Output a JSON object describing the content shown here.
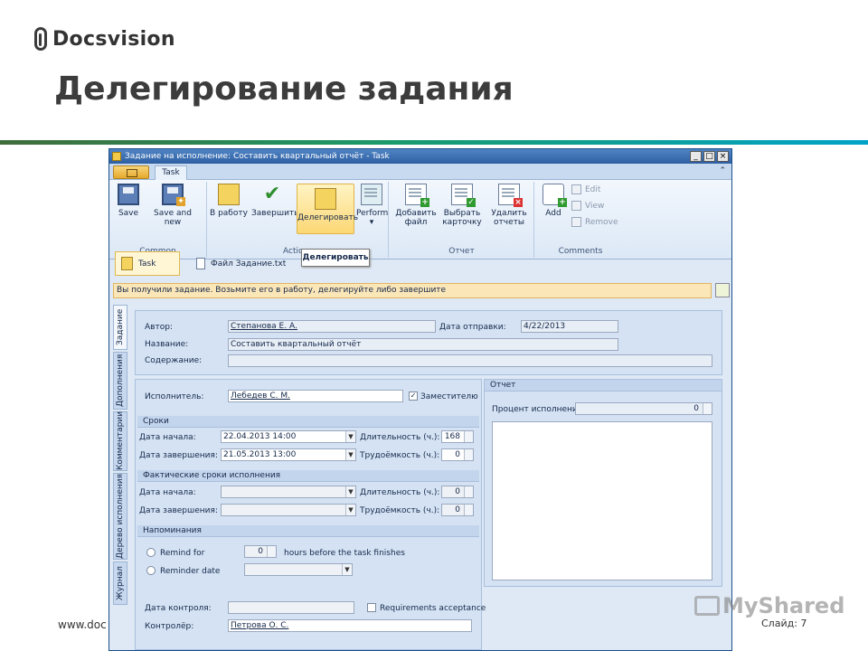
{
  "slide": {
    "logo_text": "Docsvision",
    "title": "Делегирование задания",
    "footer_url": "www.doc",
    "footer_slide": "Слайд: 7",
    "watermark": "MyShared"
  },
  "window": {
    "title": "Задание на исполнение: Составить квартальный отчёт - Task",
    "tab": "Task"
  },
  "ribbon": {
    "groups": {
      "common": "Common",
      "actions": "Actions",
      "otchet": "Отчет",
      "comments": "Comments"
    },
    "buttons": {
      "save": "Save",
      "save_new": "Save and new",
      "take": "В работу",
      "finish": "Завершить",
      "delegate": "Делегировать",
      "perform": "Perform",
      "add_file_1": "Добавить",
      "add_file_2": "файл",
      "choose_card_1": "Выбрать",
      "choose_card_2": "карточку",
      "delete_rep_1": "Удалить",
      "delete_rep_2": "отчеты",
      "add": "Add",
      "edit": "Edit",
      "view": "View",
      "remove": "Remove"
    }
  },
  "cards": {
    "task": "Task",
    "file": "Файл Задание.txt",
    "tooltip": "Делегировать"
  },
  "infobar": "Вы получили задание. Возьмите его в работу, делегируйте либо завершите",
  "side_tabs": [
    "Задание",
    "Дополнения",
    "Комментарии",
    "Дерево исполнения",
    "Журнал"
  ],
  "form": {
    "author_label": "Автор:",
    "author_value": "Степанова Е. А.",
    "sent_label": "Дата отправки:",
    "sent_value": "4/22/2013",
    "name_label": "Название:",
    "name_value": "Составить квартальный отчёт",
    "content_label": "Содержание:",
    "executor_label": "Исполнитель:",
    "executor_value": "Лебедев С. М.",
    "deputy_label": "Заместителю",
    "deputy_checked": true,
    "terms_title": "Сроки",
    "start_label": "Дата начала:",
    "start_value": "22.04.2013 14:00",
    "end_label": "Дата завершения:",
    "end_value": "21.05.2013 13:00",
    "duration_label": "Длительность (ч.):",
    "duration_value": "168",
    "effort_label": "Трудоёмкость (ч.):",
    "effort_value": "0",
    "actual_title": "Фактические сроки исполнения",
    "actual_start_label": "Дата начала:",
    "actual_end_label": "Дата завершения:",
    "actual_duration_label": "Длительность (ч.):",
    "actual_duration_value": "0",
    "actual_effort_label": "Трудоёмкость (ч.):",
    "actual_effort_value": "0",
    "reminders_title": "Напоминания",
    "remind_for_label": "Remind for",
    "remind_for_value": "0",
    "hours_before": "hours before the task finishes",
    "reminder_date_label": "Reminder date",
    "control_date_label": "Дата контроля:",
    "requirements_label": "Requirements acceptance",
    "controller_label": "Контролёр:",
    "controller_value": "Петрова О. С.",
    "report_title": "Отчет",
    "percent_label": "Процент исполнения:",
    "percent_value": "0"
  }
}
